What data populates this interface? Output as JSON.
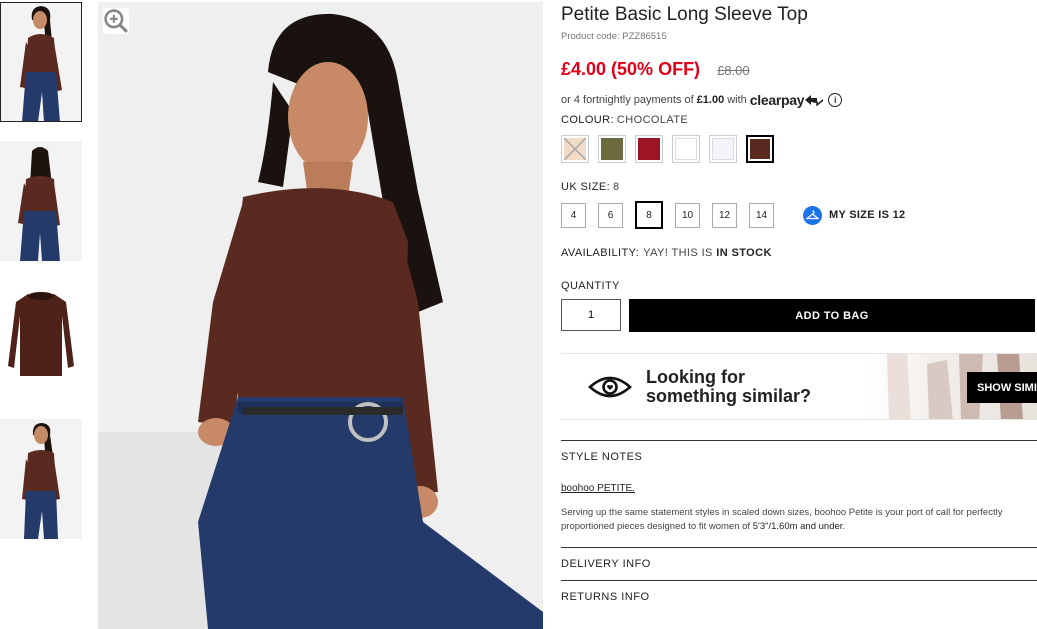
{
  "product": {
    "title": "Petite Basic Long Sleeve Top",
    "code": "Product code: PZZ86515",
    "price": "£4.00 (50% OFF)",
    "old_price": "£8.00"
  },
  "clearpay": {
    "prefix": "or 4 fortnightly payments of",
    "amount": "£1.00",
    "with": "with",
    "logo": "clearpay",
    "info_icon": "i"
  },
  "colour": {
    "label": "COLOUR:",
    "value": "CHOCOLATE",
    "swatches": [
      {
        "name": "nude",
        "color": "#f2dcc8"
      },
      {
        "name": "khaki",
        "color": "#6b6a3e"
      },
      {
        "name": "red",
        "color": "#9d1426"
      },
      {
        "name": "white",
        "color": "#ffffff"
      },
      {
        "name": "lilac-white",
        "color": "#f4f4fa"
      },
      {
        "name": "chocolate",
        "color": "#5a2a20"
      }
    ]
  },
  "size": {
    "label": "UK SIZE:",
    "value": "8",
    "options": [
      "4",
      "6",
      "8",
      "10",
      "12",
      "14"
    ],
    "selected": "8",
    "my_size": "MY SIZE IS 12"
  },
  "availability": {
    "label": "AVAILABILITY:",
    "text": "YAY! THIS IS",
    "status": "IN STOCK"
  },
  "quantity": {
    "label": "QUANTITY",
    "value": "1"
  },
  "add_to_bag": "ADD TO BAG",
  "similar": {
    "line1": "Looking for",
    "line2": "something similar?",
    "button": "SHOW SIMI"
  },
  "style_notes": {
    "title": "STYLE NOTES",
    "brand": "boohoo PETITE.",
    "text": "Serving up the same statement styles in scaled down sizes, boohoo Petite is your port of call for perfectly proportioned pieces designed to fit women of",
    "height": "5'3\"/1.60m and under",
    "end": "."
  },
  "delivery_info": "DELIVERY INFO",
  "returns_info": "RETURNS INFO",
  "colors": {
    "sale_red": "#e2001a",
    "top_brown": "#5a2a20",
    "denim": "#233a6a"
  }
}
